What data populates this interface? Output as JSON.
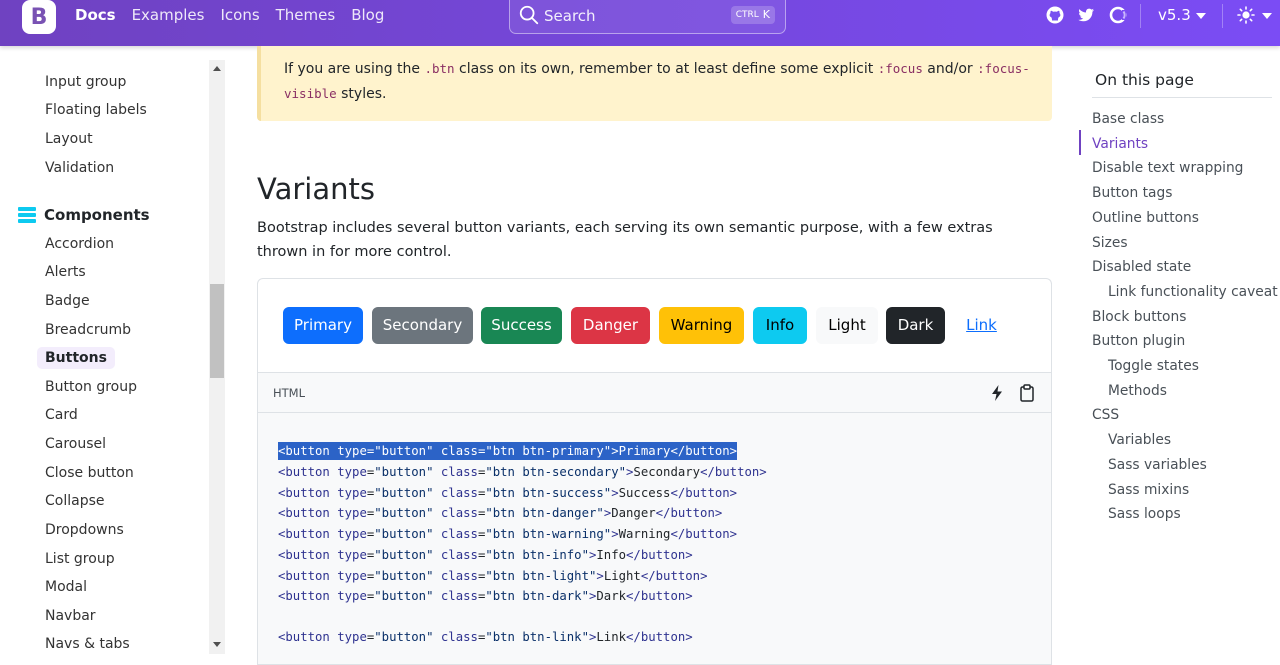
{
  "navbar": {
    "brand_letter": "B",
    "links": [
      {
        "label": "Docs",
        "active": true
      },
      {
        "label": "Examples",
        "active": false
      },
      {
        "label": "Icons",
        "active": false
      },
      {
        "label": "Themes",
        "active": false
      },
      {
        "label": "Blog",
        "active": false
      }
    ],
    "search": {
      "placeholder": "Search",
      "shortcut_mod": "CTRL",
      "shortcut_key": "K"
    },
    "icons": [
      "github-icon",
      "twitter-icon",
      "opencollective-icon"
    ],
    "version": "v5.3",
    "theme_icon": "sun-icon"
  },
  "sidebar": {
    "items_top": [
      "Input group",
      "Floating labels",
      "Layout",
      "Validation"
    ],
    "group_label": "Components",
    "group_icon": "components-icon",
    "items": [
      "Accordion",
      "Alerts",
      "Badge",
      "Breadcrumb",
      "Buttons",
      "Button group",
      "Card",
      "Carousel",
      "Close button",
      "Collapse",
      "Dropdowns",
      "List group",
      "Modal",
      "Navbar",
      "Navs & tabs"
    ],
    "active_item": "Buttons"
  },
  "callout": {
    "text_1": "If you are using the ",
    "code_1": ".btn",
    "text_2": " class on its own, remember to at least define some explicit ",
    "code_2": ":focus",
    "text_3": " and/or ",
    "code_3": ":focus-visible",
    "text_4": " styles."
  },
  "section": {
    "title": "Variants",
    "description": "Bootstrap includes several button variants, each serving its own semantic purpose, with a few extras thrown in for more control."
  },
  "example_buttons": [
    {
      "label": "Primary",
      "bg": "#0d6efd",
      "fg": "#ffffff",
      "border": "#0d6efd"
    },
    {
      "label": "Secondary",
      "bg": "#6c757d",
      "fg": "#ffffff",
      "border": "#6c757d"
    },
    {
      "label": "Success",
      "bg": "#198754",
      "fg": "#ffffff",
      "border": "#198754"
    },
    {
      "label": "Danger",
      "bg": "#dc3545",
      "fg": "#ffffff",
      "border": "#dc3545"
    },
    {
      "label": "Warning",
      "bg": "#ffc107",
      "fg": "#000000",
      "border": "#ffc107"
    },
    {
      "label": "Info",
      "bg": "#0dcaf0",
      "fg": "#000000",
      "border": "#0dcaf0"
    },
    {
      "label": "Light",
      "bg": "#f8f9fa",
      "fg": "#000000",
      "border": "#f8f9fa"
    },
    {
      "label": "Dark",
      "bg": "#212529",
      "fg": "#ffffff",
      "border": "#212529"
    },
    {
      "label": "Link",
      "bg": "transparent",
      "fg": "#0d6efd",
      "border": "transparent"
    }
  ],
  "code": {
    "language": "HTML",
    "actions": [
      "lightning-icon",
      "clipboard-icon"
    ],
    "lines": [
      {
        "cls": "btn btn-primary",
        "text": "Primary",
        "selected": true
      },
      {
        "cls": "btn btn-secondary",
        "text": "Secondary",
        "selected": false
      },
      {
        "cls": "btn btn-success",
        "text": "Success",
        "selected": false
      },
      {
        "cls": "btn btn-danger",
        "text": "Danger",
        "selected": false
      },
      {
        "cls": "btn btn-warning",
        "text": "Warning",
        "selected": false
      },
      {
        "cls": "btn btn-info",
        "text": "Info",
        "selected": false
      },
      {
        "cls": "btn btn-light",
        "text": "Light",
        "selected": false
      },
      {
        "cls": "btn btn-dark",
        "text": "Dark",
        "selected": false
      },
      {
        "cls": "btn btn-link",
        "text": "Link",
        "selected": false
      }
    ]
  },
  "toc": {
    "title": "On this page",
    "active_item": "Variants",
    "items": [
      {
        "label": "Base class",
        "level": 1
      },
      {
        "label": "Variants",
        "level": 1
      },
      {
        "label": "Disable text wrapping",
        "level": 1
      },
      {
        "label": "Button tags",
        "level": 1
      },
      {
        "label": "Outline buttons",
        "level": 1
      },
      {
        "label": "Sizes",
        "level": 1
      },
      {
        "label": "Disabled state",
        "level": 1
      },
      {
        "label": "Link functionality caveat",
        "level": 2
      },
      {
        "label": "Block buttons",
        "level": 1
      },
      {
        "label": "Button plugin",
        "level": 1
      },
      {
        "label": "Toggle states",
        "level": 2
      },
      {
        "label": "Methods",
        "level": 2
      },
      {
        "label": "CSS",
        "level": 1
      },
      {
        "label": "Variables",
        "level": 2
      },
      {
        "label": "Sass variables",
        "level": 2
      },
      {
        "label": "Sass mixins",
        "level": 2
      },
      {
        "label": "Sass loops",
        "level": 2
      }
    ]
  }
}
